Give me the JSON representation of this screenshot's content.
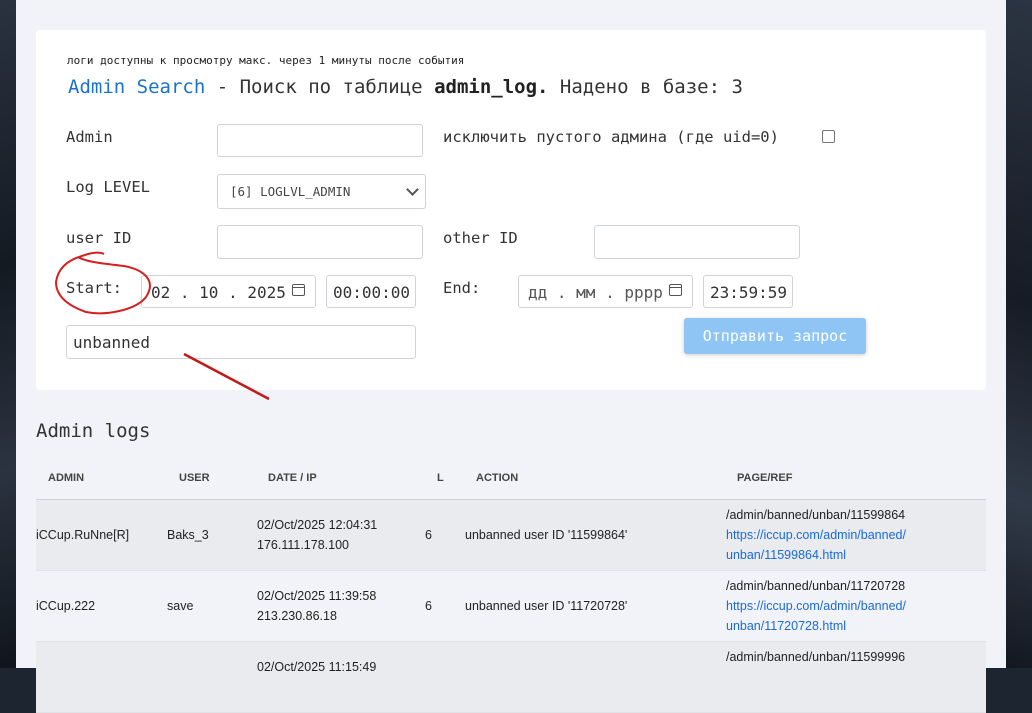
{
  "form": {
    "note": "логи доступны к просмотру макс. через 1 минуты после события",
    "title_brand": "Admin Search",
    "title_mid": " - Поиск по таблице ",
    "title_table": "admin_log.",
    "title_found": " Надено в базе: 3",
    "admin_label": "Admin",
    "admin_value": "",
    "exclude_label": "исключить пустого админа (где uid=0)",
    "exclude_checked": false,
    "log_level_label": "Log LEVEL",
    "log_level_value": "[6] LOGLVL_ADMIN",
    "user_id_label": "user ID",
    "user_id_value": "",
    "other_id_label": "other ID",
    "other_id_value": "",
    "start_label": "Start:",
    "start_date": "02 . 10 . 2025",
    "start_time": "00:00:00",
    "end_label": "End:",
    "end_date_placeholder": "дд . мм . рррр",
    "end_time": "23:59:59",
    "search_text": "unbanned",
    "submit_label": "Отправить запрос"
  },
  "logs": {
    "title": "Admin logs",
    "columns": [
      "ADMIN",
      "USER",
      "DATE / IP",
      "L",
      "ACTION",
      "PAGE/REF"
    ],
    "rows": [
      {
        "admin": "iCCup.RuNne[R]",
        "user": "Baks_3",
        "date": "02/Oct/2025 12:04:31",
        "ip": "176.111.178.100",
        "level": "6",
        "action": "unbanned user ID '11599864'",
        "page": "/admin/banned/unban/11599864",
        "ref1": "https://iccup.com/admin/banned/",
        "ref2": "unban/11599864.html"
      },
      {
        "admin": "iCCup.222",
        "user": "save",
        "date": "02/Oct/2025 11:39:58",
        "ip": "213.230.86.18",
        "level": "6",
        "action": "unbanned user ID '11720728'",
        "page": "/admin/banned/unban/11720728",
        "ref1": "https://iccup.com/admin/banned/",
        "ref2": "unban/11720728.html"
      },
      {
        "admin": "",
        "user": "",
        "date": "02/Oct/2025 11:15:49",
        "ip": "",
        "level": "",
        "action": "",
        "page": "/admin/banned/unban/11599996",
        "ref1": "",
        "ref2": ""
      }
    ]
  },
  "colors": {
    "brand": "#1a73c8",
    "button": "#8ec5f5",
    "annotation": "#d42020",
    "link": "#1a6bd1"
  }
}
